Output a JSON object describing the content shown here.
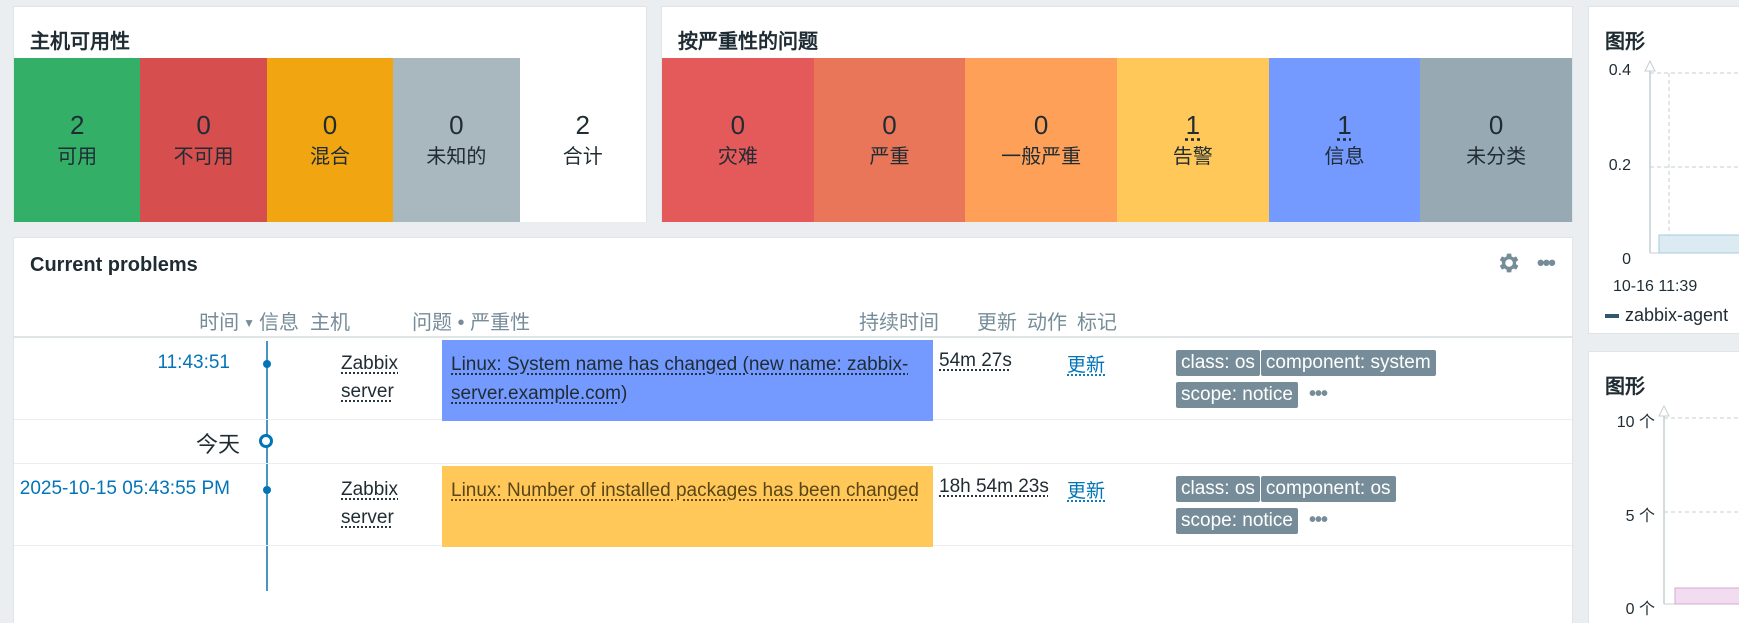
{
  "host_availability": {
    "title": "主机可用性",
    "cells": [
      {
        "count": "2",
        "label": "可用",
        "color": "#34af67",
        "text_color": "#1f2c33"
      },
      {
        "count": "0",
        "label": "不可用",
        "color": "#d64e4e",
        "text_color": "#1f2c33"
      },
      {
        "count": "0",
        "label": "混合",
        "color": "#f0a511",
        "text_color": "#1f2c33"
      },
      {
        "count": "0",
        "label": "未知的",
        "color": "#a9b8be",
        "text_color": "#1f2c33"
      },
      {
        "count": "2",
        "label": "合计",
        "color": "#ffffff",
        "text_color": "#1f2c33"
      }
    ]
  },
  "problems_by_severity": {
    "title": "按严重性的问题",
    "cells": [
      {
        "count": "0",
        "label": "灾难",
        "color": "#e45959",
        "link": false
      },
      {
        "count": "0",
        "label": "严重",
        "color": "#e97659",
        "link": false
      },
      {
        "count": "0",
        "label": "一般严重",
        "color": "#ffa059",
        "link": false
      },
      {
        "count": "1",
        "label": "告警",
        "color": "#ffc859",
        "link": true
      },
      {
        "count": "1",
        "label": "信息",
        "color": "#7499ff",
        "link": true
      },
      {
        "count": "0",
        "label": "未分类",
        "color": "#97aab3",
        "link": false
      }
    ]
  },
  "current_problems": {
    "title": "Current problems",
    "columns": {
      "time": "时间",
      "info": "信息",
      "host": "主机",
      "problem": "问题 • 严重性",
      "duration": "持续时间",
      "update": "更新",
      "actions": "动作",
      "tags": "标记"
    },
    "today_label": "今天",
    "rows": [
      {
        "time": "11:43:51",
        "host_line1": "Zabbix",
        "host_line2": "server",
        "problem": "Linux: System name has changed (new name: zabbix-server.example.com)",
        "severity_color": "#7499ff",
        "problem_text_color": "#1f2c33",
        "duration": "54m 27s",
        "update": "更新",
        "tags": [
          "class: os",
          "component: system",
          "scope: notice"
        ]
      },
      {
        "time": "2025-10-15 05:43:55 PM",
        "host_line1": "Zabbix",
        "host_line2": "server",
        "problem": "Linux: Number of installed packages has been changed",
        "severity_color": "#ffc859",
        "problem_text_color": "#5a4516",
        "duration": "18h 54m 23s",
        "update": "更新",
        "tags": [
          "class: os",
          "component: os",
          "scope: notice"
        ]
      }
    ],
    "more_glyph": "•••"
  },
  "graph1": {
    "title": "图形",
    "y_ticks": [
      "0.4",
      "0.2",
      "0"
    ],
    "x_label": "10-16 11:39",
    "legend": "zabbix-agent"
  },
  "graph2": {
    "title": "图形",
    "y_ticks": [
      "10 个",
      "5 个",
      "0 个"
    ]
  }
}
